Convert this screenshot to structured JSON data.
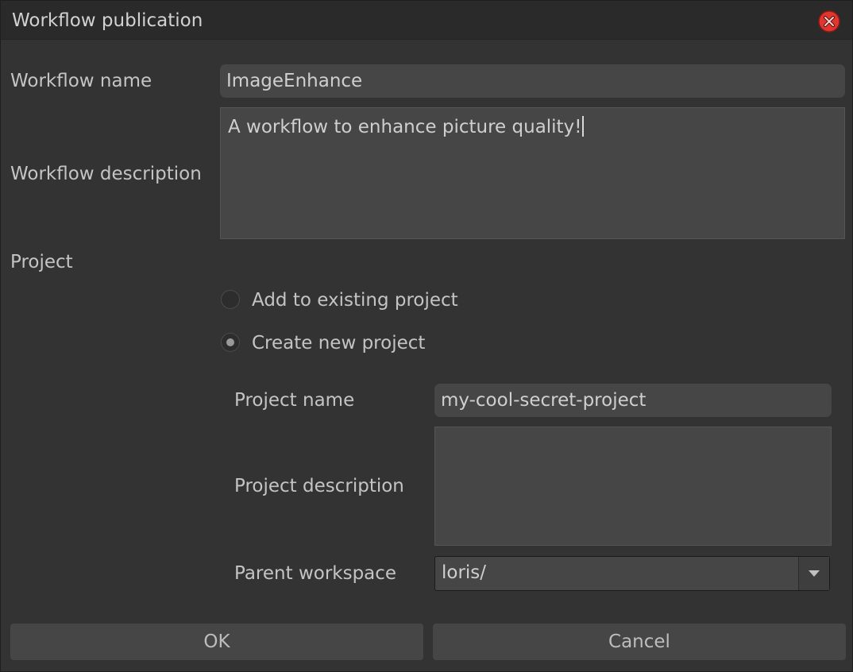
{
  "window": {
    "title": "Workflow publication",
    "close_icon": "close-icon"
  },
  "form": {
    "workflow_name_label": "Workflow name",
    "workflow_name_value": "ImageEnhance",
    "workflow_description_label": "Workflow description",
    "workflow_description_value": "A workflow to enhance picture quality!",
    "project_label": "Project",
    "options": [
      {
        "label": "Add to existing project",
        "checked": false
      },
      {
        "label": "Create new project",
        "checked": true
      }
    ],
    "project_name_label": "Project name",
    "project_name_value": "my-cool-secret-project",
    "project_description_label": "Project description",
    "project_description_value": "",
    "parent_workspace_label": "Parent workspace",
    "parent_workspace_value": "loris/"
  },
  "buttons": {
    "ok": "OK",
    "cancel": "Cancel"
  },
  "colors": {
    "background": "#333333",
    "titlebar": "#2a2a2a",
    "field": "#464646",
    "close_red": "#e0362f"
  }
}
